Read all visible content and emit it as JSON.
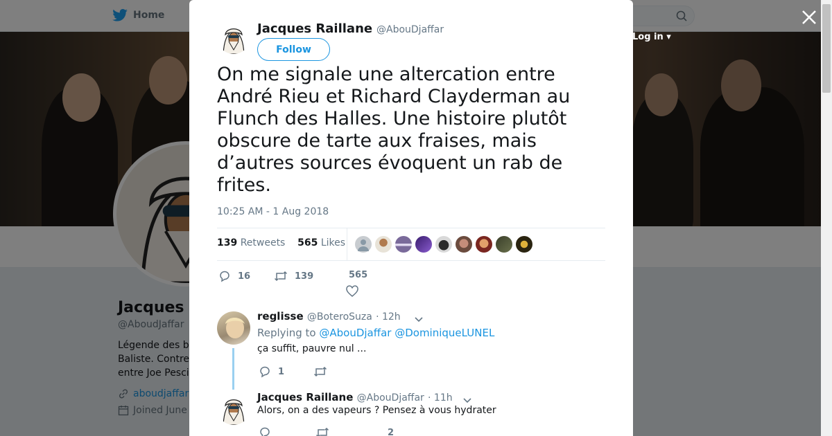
{
  "nav": {
    "home_label": "Home",
    "login_label": "Log in"
  },
  "profile": {
    "name": "Jacques R",
    "handle": "@AboudJaffar",
    "bio_lines": [
      "Légende des b",
      "Baliste. Contre",
      "entre Joe Pesci"
    ],
    "link": "aboudjaffar",
    "joined": "Joined June"
  },
  "tweet": {
    "author_name": "Jacques Raillane",
    "author_handle": "@AbouDjaffar",
    "follow_label": "Follow",
    "text": "On me signale une altercation entre André Rieu et Richard Clayderman au Flunch des Halles. Une histoire plutôt obscure de tarte aux fraises, mais d’autres sources évoquent un rab de frites.",
    "timestamp": "10:25 AM - 1 Aug 2018",
    "retweets_count": "139",
    "retweets_label": "Retweets",
    "likes_count": "565",
    "likes_label": "Likes",
    "actions": {
      "replies": "16",
      "retweets": "139",
      "likes": "565"
    }
  },
  "replies": [
    {
      "name": "reglisse",
      "handle": "@BoteroSuza",
      "time": "· 12h",
      "replying_prefix": "Replying to",
      "mentions": [
        "@AbouDjaffar",
        "@DominiqueLUNEL"
      ],
      "text": "ça suffit, pauvre nul ...",
      "reply_count": "1"
    },
    {
      "name": "Jacques Raillane",
      "handle": "@AbouDjaffar",
      "time": "· 11h",
      "text": "Alors, on a des vapeurs ? Pensez à vous hydrater",
      "like_count": "2"
    }
  ],
  "colors": {
    "accent": "#1b95e0",
    "thread_line": "#9ad0f0",
    "muted": "#657786"
  }
}
